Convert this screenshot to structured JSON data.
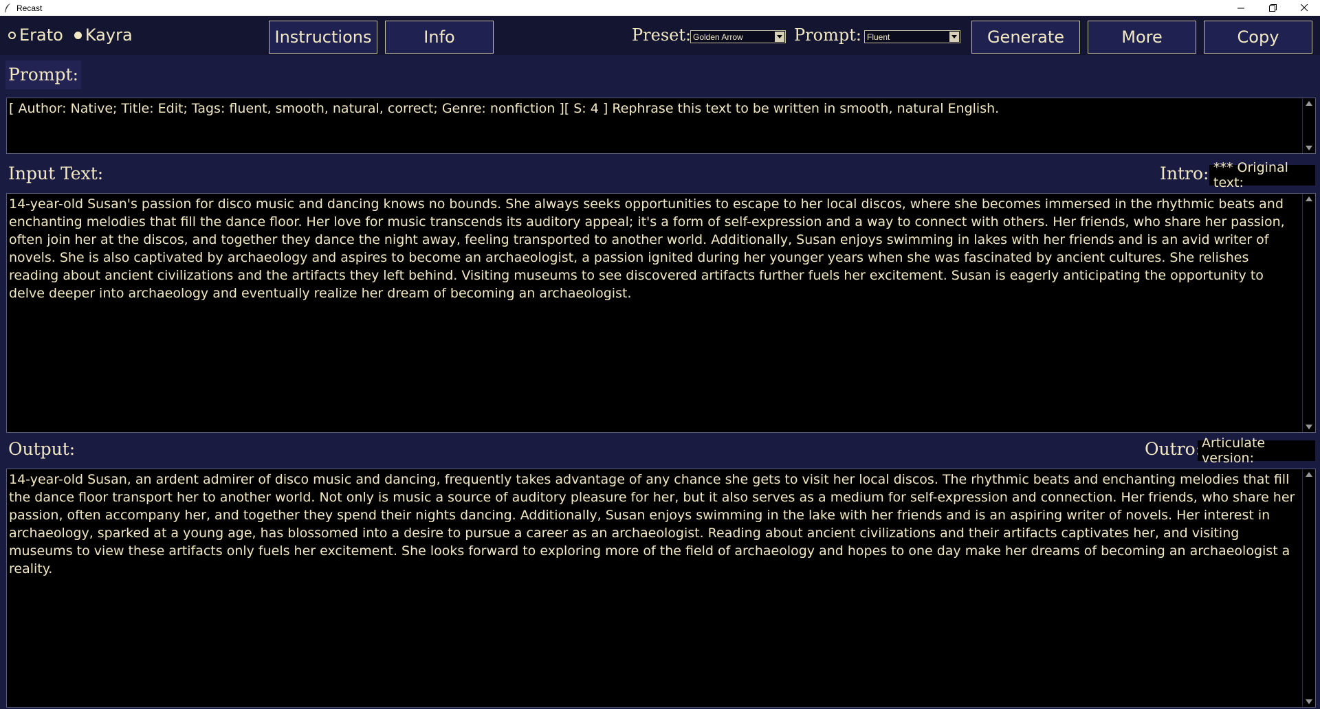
{
  "window": {
    "title": "Recast",
    "app_icon": "feather-icon",
    "controls": [
      "minimize-icon",
      "maximize-icon",
      "close-icon"
    ]
  },
  "toolbar": {
    "radios": [
      {
        "label": "Erato",
        "selected": false
      },
      {
        "label": "Kayra",
        "selected": true
      }
    ],
    "instructions_label": "Instructions",
    "info_label": "Info",
    "preset_label": "Preset:",
    "preset_value": "Golden Arrow",
    "prompt_label": "Prompt:",
    "prompt_value": "Fluent",
    "generate_label": "Generate",
    "more_label": "More",
    "copy_label": "Copy"
  },
  "prompt_section": {
    "label": "Prompt:",
    "text": "[ Author: Native; Title: Edit; Tags: fluent, smooth, natural, correct; Genre: nonfiction ][ S: 4 ] Rephrase this text to be written in smooth, natural English."
  },
  "input_section": {
    "label": "Input Text:",
    "intro_label": "Intro:",
    "intro_value": "*** Original text:",
    "text": "14-year-old Susan's passion for disco music and dancing knows no bounds. She always seeks opportunities to escape to her local discos, where she becomes immersed in the rhythmic beats and enchanting melodies that fill the dance floor. Her love for music transcends its auditory appeal; it's a form of self-expression and a way to connect with others. Her friends, who share her passion, often join her at the discos, and together they dance the night away, feeling transported to another world. Additionally, Susan enjoys swimming in lakes with her friends and is an avid writer of novels. She is also captivated by archaeology and aspires to become an archaeologist, a passion ignited during her younger years when she was fascinated by ancient cultures. She relishes reading about ancient civilizations and the artifacts they left behind. Visiting museums to see discovered artifacts further fuels her excitement. Susan is eagerly anticipating the opportunity to delve deeper into archaeology and eventually realize her dream of becoming an archaeologist."
  },
  "output_section": {
    "label": "Output:",
    "outro_label": "Outro:",
    "outro_value": "Articulate version:",
    "text": "14-year-old Susan, an ardent admirer of disco music and dancing, frequently takes advantage of any chance she gets to visit her local discos. The rhythmic beats and enchanting melodies that fill the dance floor transport her to another world. Not only is music a source of auditory pleasure for her, but it also serves as a medium for self-expression and connection. Her friends, who share her passion, often accompany her, and together they spend their nights dancing. Additionally, Susan enjoys swimming in the lake with her friends and is an aspiring writer of novels. Her interest in archaeology, sparked at a young age, has blossomed into a desire to pursue a career as an archaeologist. Reading about ancient civilizations and their artifacts captivates her, and visiting museums to view these artifacts only fuels her excitement. She looks forward to exploring more of the field of archaeology and hopes to one day make her dreams of becoming an archaeologist a reality."
  },
  "colors": {
    "background": "#1a1b40",
    "toolbar": "#141530",
    "text": "#f2e9c4",
    "field": "#000000"
  }
}
